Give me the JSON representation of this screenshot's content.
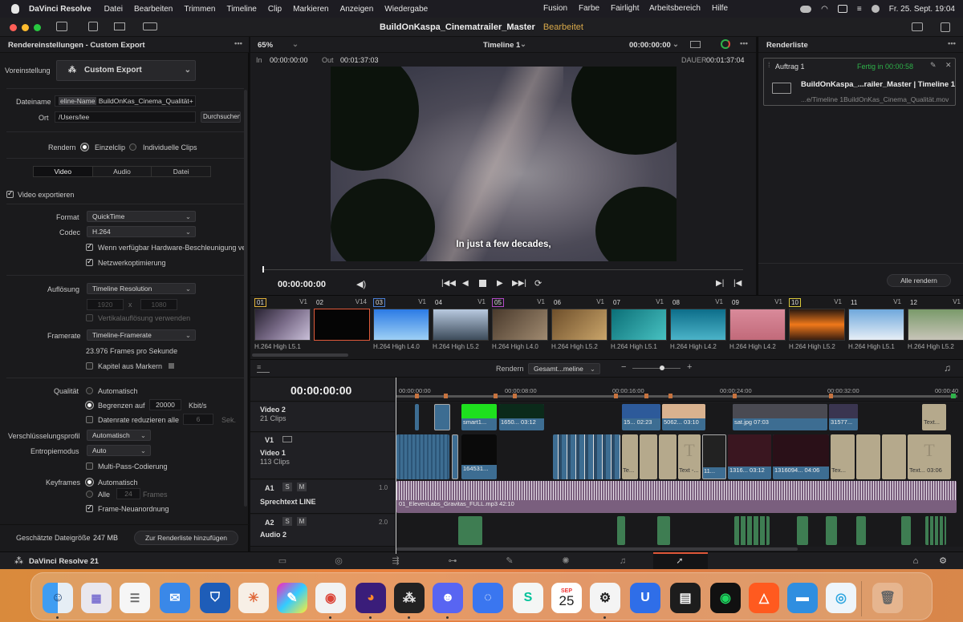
{
  "menubar": {
    "app": "DaVinci Resolve",
    "items": [
      "Datei",
      "Bearbeiten",
      "Trimmen",
      "Timeline",
      "Clip",
      "Markieren",
      "Anzeigen",
      "Wiedergabe"
    ],
    "right_items": [
      "Fusion",
      "Farbe",
      "Fairlight",
      "Arbeitsbereich",
      "Hilfe"
    ],
    "clock": "Fr. 25. Sept. 19:04"
  },
  "titlebar": {
    "project": "BuildOnKaspa_Cinematrailer_Master",
    "state": "Bearbeitet"
  },
  "render_settings": {
    "header": "Rendereinstellungen - Custom Export",
    "preset_label": "Voreinstellung",
    "preset_value": "Custom Export",
    "filename_label": "Dateiname",
    "filename_tag": "eline-Name",
    "filename_value": "BuildOnKas_Cinema_Qualität+",
    "location_label": "Ort",
    "location_value": "/Users/lee",
    "browse": "Durchsuchen",
    "render_label": "Rendern",
    "single_clip": "Einzelclip",
    "individual_clips": "Individuelle Clips",
    "tabs": [
      "Video",
      "Audio",
      "Datei"
    ],
    "export_video": "Video exportieren",
    "format_label": "Format",
    "format_value": "QuickTime",
    "codec_label": "Codec",
    "codec_value": "H.264",
    "hw_accel": "Wenn verfügbar Hardware-Beschleunigung verwenden",
    "network_opt": "Netzwerkoptimierung",
    "resolution_label": "Auflösung",
    "resolution_value": "Timeline Resolution",
    "res_w": "1920",
    "res_x": "x",
    "res_h": "1080",
    "vertical_res": "Vertikalauflösung verwenden",
    "framerate_label": "Framerate",
    "framerate_value": "Timeline-Framerate",
    "fps_text": "23.976 Frames pro Sekunde",
    "chapters": "Kapitel aus Markern",
    "quality_label": "Qualität",
    "quality_auto": "Automatisch",
    "quality_limit": "Begrenzen auf",
    "quality_limit_value": "20000",
    "quality_unit": "Kbit/s",
    "datarate_reduce": "Datenrate reduzieren alle",
    "datarate_value": "6",
    "datarate_unit": "Sek.",
    "encryption_label": "Verschlüsselungsprofil",
    "encryption_value": "Automatisch",
    "entropy_label": "Entropiemodus",
    "entropy_value": "Auto",
    "multipass": "Multi-Pass-Codierung",
    "keyframes_label": "Keyframes",
    "keyframes_auto": "Automatisch",
    "keyframes_all": "Alle",
    "keyframes_value": "24",
    "keyframes_unit": "Frames",
    "frame_reorder": "Frame-Neuanordnung",
    "est_size_label": "Geschätzte Dateigröße",
    "est_size_value": "247 MB",
    "add_queue": "Zur Renderliste hinzufügen"
  },
  "viewer": {
    "zoom": "65%",
    "timeline_name": "Timeline 1",
    "top_tc": "00:00:00:00",
    "in_label": "In",
    "in_tc": "00:00:00:00",
    "out_label": "Out",
    "out_tc": "00:01:37:03",
    "duration_label": "DAUER",
    "duration_tc": "00:01:37:04",
    "subtitle": "In just a few decades,",
    "current_tc": "00:00:00:00",
    "playhead_fraction": 0.0
  },
  "render_queue": {
    "header": "Renderliste",
    "job_name": "Auftrag 1",
    "job_status": "Fertig in 00:00:58",
    "job_title": "BuildOnKaspa_...railer_Master | Timeline 1",
    "job_path": "...e/Timeline 1BuildOnKas_Cinema_Qualität.mov",
    "render_all": "Alle rendern",
    "accent": "#2fb24a"
  },
  "clips": [
    {
      "num": "01",
      "track": "V1",
      "codec": "H.264 High L5.1"
    },
    {
      "num": "02",
      "track": "V14",
      "codec": ""
    },
    {
      "num": "03",
      "track": "V1",
      "codec": "H.264 High L4.0"
    },
    {
      "num": "04",
      "track": "V1",
      "codec": "H.264 High L5.2"
    },
    {
      "num": "05",
      "track": "V1",
      "codec": "H.264 High L4.0"
    },
    {
      "num": "06",
      "track": "V1",
      "codec": "H.264 High L5.2"
    },
    {
      "num": "07",
      "track": "V1",
      "codec": "H.264 High L5.1"
    },
    {
      "num": "08",
      "track": "V1",
      "codec": "H.264 High L4.2"
    },
    {
      "num": "09",
      "track": "V1",
      "codec": "H.264 High L4.2"
    },
    {
      "num": "10",
      "track": "V1",
      "codec": "H.264 High L5.2"
    },
    {
      "num": "11",
      "track": "V1",
      "codec": "H.264 High L5.1"
    },
    {
      "num": "12",
      "track": "V1",
      "codec": "H.264 High L5.2"
    }
  ],
  "timeline": {
    "render_label": "Rendern",
    "render_scope": "Gesamt...meline",
    "tc": "00:00:00:00",
    "ruler": [
      "00:00:00:00",
      "00:00:08:00",
      "00:00:16:00",
      "00:00:24:00",
      "00:00:32:00",
      "00:00:40"
    ],
    "tracks": [
      {
        "id": "",
        "name": "Video 2",
        "sub": "21 Clips"
      },
      {
        "id": "V1",
        "name": "Video 1",
        "sub": "113 Clips"
      },
      {
        "id": "A1",
        "name": "Sprechtext LINE",
        "sub": "",
        "level": "1.0"
      },
      {
        "id": "A2",
        "name": "Audio 2",
        "sub": "",
        "level": "2.0"
      }
    ],
    "track_btn_s": "S",
    "track_btn_m": "M",
    "v2_clips": [
      "smart1...",
      "1650...  03:12",
      "15...  02:23",
      "5062...  03:10",
      "sat.jpg  07:03",
      "31577...",
      "Text..."
    ],
    "v1_clips": [
      "164531...",
      "Te...",
      "Text -...",
      "11...",
      "1316...  03:12",
      "1316094...  04:06",
      "Tex...",
      "Text...  03:06"
    ],
    "audio_clip": "01_ElevenLabs_Gravitas_FULL.mp3  42:10"
  },
  "pagebar": {
    "app_label": "DaVinci Resolve 21",
    "active_index": 7
  },
  "dock": {
    "calendar_month": "SEP",
    "calendar_day": "25"
  }
}
